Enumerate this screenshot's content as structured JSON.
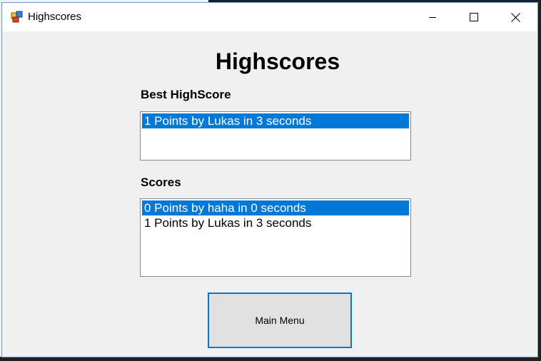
{
  "window": {
    "title": "Highscores",
    "icon": "app-window-icon",
    "controls": [
      "minimize-icon",
      "maximize-icon",
      "close-icon"
    ]
  },
  "main": {
    "heading": "Highscores",
    "best_label": "Best HighScore",
    "best_items": [
      {
        "text": "1 Points by Lukas in 3 seconds",
        "selected": true
      }
    ],
    "scores_label": "Scores",
    "score_items": [
      {
        "text": "0 Points by haha in 0 seconds",
        "selected": true
      },
      {
        "text": "1 Points by Lukas in 3 seconds",
        "selected": false
      }
    ],
    "menu_button": "Main Menu"
  },
  "colors": {
    "selection": "#0078d7",
    "window_bg": "#f0f0f0",
    "button_border": "#0078d7"
  }
}
